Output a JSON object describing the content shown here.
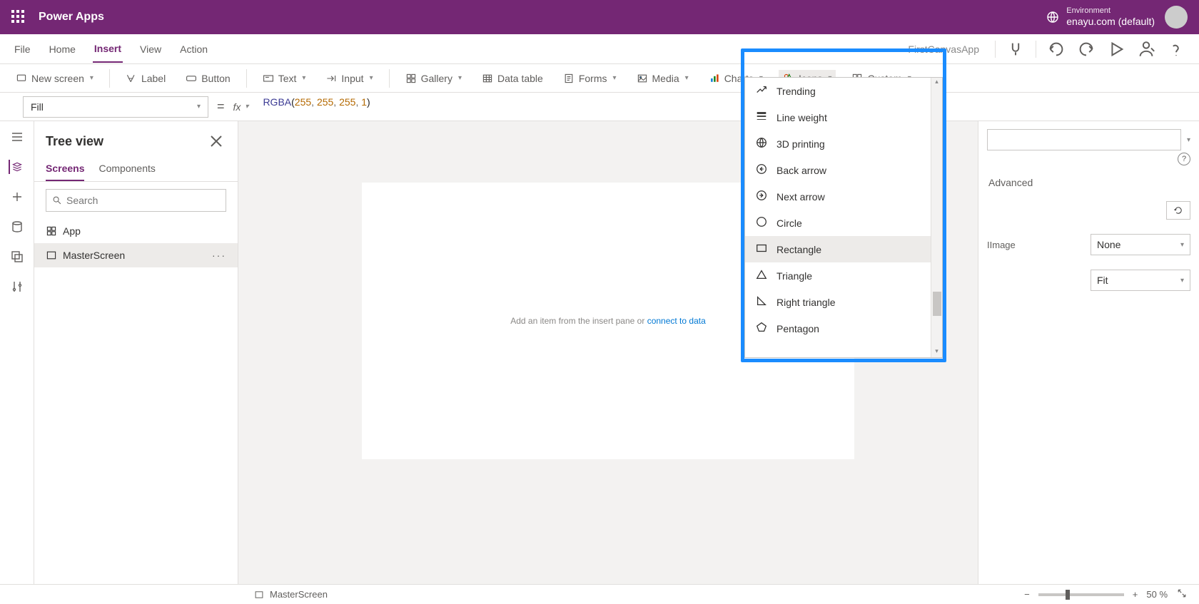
{
  "header": {
    "app_title": "Power Apps",
    "env_label": "Environment",
    "env_name": "enayu.com (default)"
  },
  "menubar": {
    "items": [
      "File",
      "Home",
      "Insert",
      "View",
      "Action"
    ],
    "active": "Insert",
    "app_name": "FirstCanvasApp"
  },
  "ribbon": {
    "new_screen": "New screen",
    "label_btn": "Label",
    "button_btn": "Button",
    "text_btn": "Text",
    "input_btn": "Input",
    "gallery_btn": "Gallery",
    "data_table_btn": "Data table",
    "forms_btn": "Forms",
    "media_btn": "Media",
    "charts_btn": "Charts",
    "icons_btn": "Icons",
    "custom_btn": "Custom"
  },
  "formula": {
    "property": "Fill",
    "fn": "RGBA",
    "args": [
      "255",
      "255",
      "255",
      "1"
    ]
  },
  "tree": {
    "title": "Tree view",
    "tabs": [
      "Screens",
      "Components"
    ],
    "active_tab": "Screens",
    "search_ph": "Search",
    "app_node": "App",
    "selected_node": "MasterScreen"
  },
  "canvas": {
    "hint_pre": "Add an item from the insert pane ",
    "hint_or": "or ",
    "hint_link": "connect to data"
  },
  "props": {
    "tab": "Advanced",
    "bg_image_label": "Image",
    "bg_image_value": "None",
    "fit_label": "",
    "fit_value": "Fit"
  },
  "icons_menu": {
    "items": [
      {
        "label": "Trending",
        "icon": "trending"
      },
      {
        "label": "Line weight",
        "icon": "lineweight"
      },
      {
        "label": "3D printing",
        "icon": "3d"
      },
      {
        "label": "Back arrow",
        "icon": "backarrow"
      },
      {
        "label": "Next arrow",
        "icon": "nextarrow"
      },
      {
        "label": "Circle",
        "icon": "circle"
      },
      {
        "label": "Rectangle",
        "icon": "rectangle",
        "hover": true
      },
      {
        "label": "Triangle",
        "icon": "triangle"
      },
      {
        "label": "Right triangle",
        "icon": "righttriangle"
      },
      {
        "label": "Pentagon",
        "icon": "pentagon"
      }
    ]
  },
  "status": {
    "screen_name": "MasterScreen",
    "zoom": "50",
    "zoom_suffix": "%"
  }
}
